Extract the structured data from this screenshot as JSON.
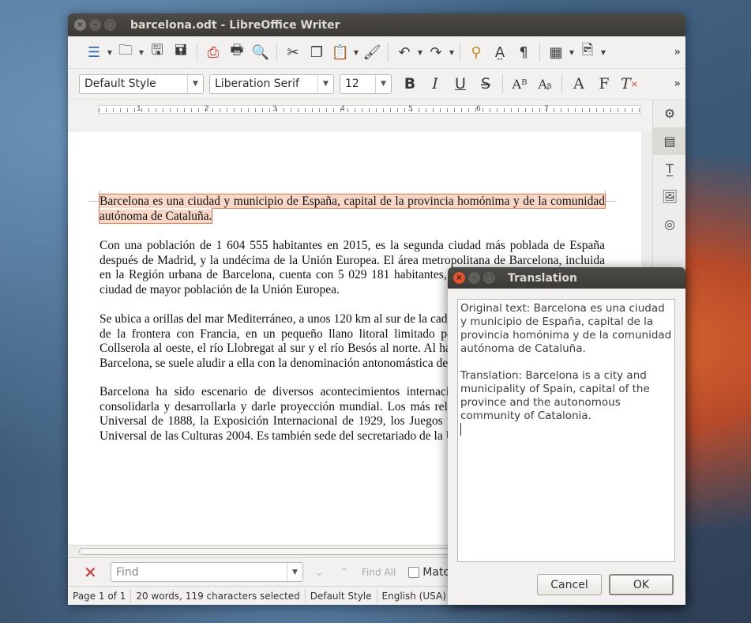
{
  "writer": {
    "title": "barcelona.odt - LibreOffice Writer",
    "format": {
      "style": "Default Style",
      "font": "Liberation Serif",
      "size": "12"
    },
    "ruler_numbers": [
      "1",
      "2",
      "3",
      "4",
      "5",
      "6",
      "7"
    ],
    "document": {
      "p1": "Barcelona es una ciudad y municipio de España, capital de la provincia homónima y de la comunidad autónoma de Cataluña.",
      "p2": "Con una población de 1 604 555 habitantes en 2015, es la segunda ciudad más poblada de España después de Madrid, y la undécima de la Unión Europea. El área metropolitana de Barcelona, incluida en la Región urbana de Barcelona, cuenta con 5 029 181 habitantes, lo que la convierte en la sexta ciudad de mayor población de la Unión Europea.",
      "p3": "Se ubica a orillas del mar Mediterráneo, a unos 120 km al sur de la cadena montañosa de los Pirineos y de la frontera con Francia, en un pequeño llano litoral limitado por el mar al este, la sierra de Collserola al oeste, el río Llobregat al sur y el río Besós al norte. Al haber sido capital del condado de Barcelona, se suele aludir a ella con la denominación antonomástica de Ciudad Condal.",
      "p4": "Barcelona ha sido escenario de diversos acontecimientos internacionales que han contribuido a consolidarla y desarrollarla y darle proyección mundial. Los más relevantes han sido la Exposición Universal de 1888, la Exposición Internacional de 1929, los Juegos Olímpicos de 1992 y el Fórum Universal de las Culturas 2004. Es también sede del secretariado de la Unión por el Mediterráneo."
    },
    "find": {
      "placeholder": "Find",
      "find_all": "Find All",
      "match_case": "Match Case"
    },
    "status": {
      "page": "Page 1 of 1",
      "words": "20 words, 119 characters selected",
      "style": "Default Style",
      "language": "English (USA)"
    }
  },
  "dialog": {
    "title": "Translation",
    "original": "Original text: Barcelona es una ciudad y municipio de España, capital de la provincia homónima y de la comunidad autónoma de Cataluña.",
    "translation": "Translation: Barcelona is a city and municipality of Spain, capital of the province and the autonomous community of Catalonia.",
    "cancel_label": "Cancel",
    "ok_label": "OK"
  },
  "colors": {
    "selection_fill": "#f8d7c7",
    "selection_border": "#e2734f",
    "titlebar": "#3c3b37",
    "spellcheck": "#dd3333"
  },
  "icons": {
    "toolbar": [
      "sidebar-toggle-icon",
      "open-icon",
      "save-icon",
      "save-as-icon",
      "export-pdf-icon",
      "print-icon",
      "print-preview-icon",
      "cut-icon",
      "copy-icon",
      "paste-icon",
      "clone-format-icon",
      "undo-icon",
      "redo-icon",
      "find-replace-icon",
      "spelling-icon",
      "formatting-marks-icon",
      "insert-table-icon",
      "insert-image-icon"
    ],
    "format": [
      "bold-icon",
      "italic-icon",
      "underline-icon",
      "strikethrough-icon",
      "superscript-icon",
      "subscript-icon",
      "shadow-icon",
      "outline-icon",
      "clear-format-icon"
    ],
    "sidebar": [
      "properties-icon",
      "page-icon",
      "styles-icon",
      "gallery-icon",
      "navigator-icon"
    ]
  }
}
